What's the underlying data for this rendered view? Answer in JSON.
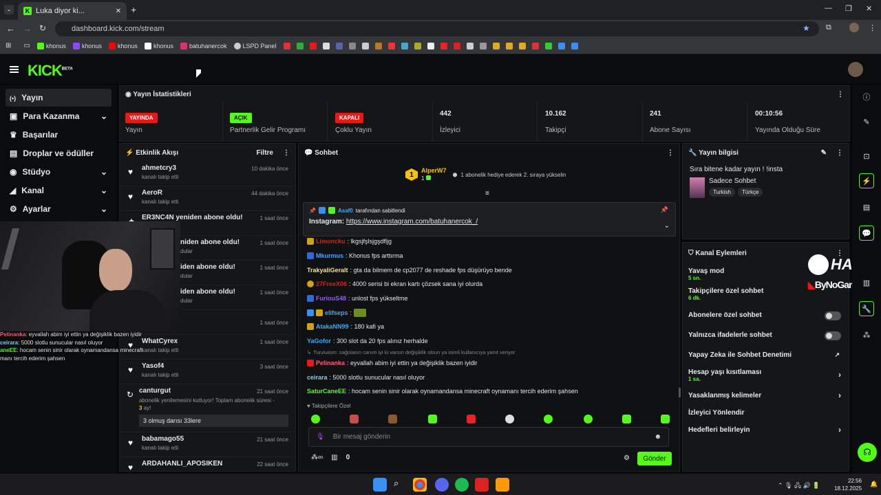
{
  "browser": {
    "tab_title": "Luka diyor ki...",
    "url": "dashboard.kick.com/stream",
    "bookmarks": [
      {
        "label": "khonus",
        "color": "#53fc18"
      },
      {
        "label": "khonus",
        "color": "#9146ff"
      },
      {
        "label": "khonus",
        "color": "#ff0000"
      },
      {
        "label": "khonus",
        "color": "#ffffff"
      },
      {
        "label": "batuhanercok",
        "color": "#e1306c"
      },
      {
        "label": "LSPD Panel",
        "color": "#cccccc"
      }
    ]
  },
  "header": {
    "logo": "KICK",
    "logo_sup": "BETA"
  },
  "sidebar": {
    "items": [
      {
        "label": "Yayın",
        "icon": "broadcast-icon",
        "active": true
      },
      {
        "label": "Para Kazanma",
        "icon": "money-icon",
        "chev": true
      },
      {
        "label": "Başarılar",
        "icon": "trophy-icon"
      },
      {
        "label": "Droplar ve ödüller",
        "icon": "gift-icon"
      },
      {
        "label": "Stüdyo",
        "icon": "studio-icon",
        "chev": true
      },
      {
        "label": "Kanal",
        "icon": "channel-icon",
        "chev": true
      },
      {
        "label": "Ayarlar",
        "icon": "gear-icon",
        "chev": true
      }
    ]
  },
  "stats": {
    "title": "Yayın İstatistikleri",
    "items": [
      {
        "badge": "YAYINDA",
        "badge_color": "#e91916",
        "label": "Yayın"
      },
      {
        "badge": "AÇIK",
        "badge_color": "#53fc18",
        "label": "Partnerlik Gelir Programı"
      },
      {
        "badge": "KAPALI",
        "badge_color": "#e91916",
        "label": "Çoklu Yayın"
      },
      {
        "value": "442",
        "label": "İzleyici"
      },
      {
        "value": "10.162",
        "label": "Takipçi"
      },
      {
        "value": "241",
        "label": "Abone Sayısı"
      },
      {
        "value": "00:10:56",
        "label": "Yayında Olduğu Süre"
      }
    ]
  },
  "activity": {
    "title": "Etkinlik Akışı",
    "filter": "Filtre",
    "items": [
      {
        "user": "ahmetcry3",
        "sub": "kanalı takip etti",
        "time": "10 dakika önce"
      },
      {
        "user": "AeroR",
        "sub": "kanalı takip etti",
        "time": "44 dakika önce"
      },
      {
        "user": "ER3NC4N yeniden abone oldu!",
        "sub": "",
        "time": "1 saat önce"
      },
      {
        "user": "niden abone oldu!",
        "sub": "dular",
        "time": "1 saat önce"
      },
      {
        "user": "iden abone oldu!",
        "sub": "dular",
        "time": "1 saat önce"
      },
      {
        "user": "iden abone oldu!",
        "sub": "dular",
        "time": "1 saat önce"
      },
      {
        "user": "",
        "sub": "kanalı takip etti",
        "time": "1 saat önce"
      },
      {
        "user": "WhatCyrex",
        "sub": "kanalı takip etti",
        "time": "1 saat önce"
      },
      {
        "user": "Yasof4",
        "sub": "kanalı takip etti",
        "time": "3 saat önce"
      }
    ],
    "resub": {
      "user": "canturgut",
      "text": "abonelik yenilemesini kutluyor! Toplam abonelik süresi -",
      "months": "3",
      "unit": "ay!",
      "message": "3 olmuş darısı 33lere",
      "time": "21 saat önce"
    },
    "tail": [
      {
        "user": "babamago55",
        "sub": "kanalı takip etti",
        "time": "21 saat önce"
      },
      {
        "user": "ARDAHANLI_APOSIKEN",
        "sub": "",
        "time": "22 saat önce"
      }
    ]
  },
  "overlay": {
    "brand": "HAWK",
    "brand2": "ByNoGame",
    "chat": [
      {
        "user": "Pelinanka",
        "text": ": eyvallah abim iyi ettin ya değişiklik bazen iyidir",
        "color": "#ff5e7a"
      },
      {
        "user": "ceirara",
        "text": ": 5000 slotlu sunucular nasıl oluyor",
        "color": "#7ad2ff"
      },
      {
        "user": "aneEE",
        "text": ": hocam senin sinir olarak oynamandansa minecraft",
        "color": "#53fc18"
      },
      {
        "user": "",
        "text": "manı tercih ederim şahsen",
        "color": "#fff"
      }
    ]
  },
  "chat": {
    "title": "Sohbet",
    "top": {
      "rank": "1",
      "user": "AlperW7",
      "count": "1",
      "text": "1 abonelik hediye ederek 2. sıraya yükselin"
    },
    "pinned": {
      "by_user": "Asaf0",
      "by_text": "tarafından sabitlendi",
      "label": "Instagram:",
      "link": "https://www.instagram.com/batuhanercok_/"
    },
    "messages": [
      {
        "user": "Limoncku",
        "text": ": lkgsjfşlsjgşdfljg",
        "color": "#e91916",
        "badge": "#d4a017"
      },
      {
        "user": "Mkurmus",
        "text": ": Khonus fps arttırma",
        "color": "#3fa9f5",
        "badge": "#2f6bd8"
      },
      {
        "user": "TrakyaliGeralt",
        "text": ": gta da bilmem de cp2077 de reshade fps düşürüyo bende",
        "color": "#f0e68c",
        "badge": ""
      },
      {
        "user": "27FreeX06",
        "text": ": 4000 serisi bi ekran kartı çözsek sana iyi olurda",
        "color": "#e91916",
        "badge": "#d4a017"
      },
      {
        "user": "FuriouS48",
        "text": ": unlost fps yükseltme",
        "color": "#9b59ff",
        "badge": "#2f6bd8"
      },
      {
        "user": "elifseps",
        "text": ":",
        "color": "#3fa9f5",
        "badge": "#2f6bd8"
      },
      {
        "user": "AtakaNN99",
        "text": ": 180 kafi ya",
        "color": "#3fa9f5",
        "badge": "#d4a017"
      },
      {
        "user": "YaGofor",
        "text": ": 300 slot da 20 fps alınız herhalde",
        "color": "#3fa9f5",
        "badge": ""
      },
      {
        "user": "Pelinanka",
        "text": ": eyvallah abim iyi ettin ya değişiklik bazen iyidir",
        "color": "#ff5e7a",
        "badge": "#e91916",
        "reply": "TunAxiom: sağolasın canım iyi ki varsın değişiklik olsun ya isimli kullanıcıya yanıt veriyor"
      },
      {
        "user": "ceirara",
        "text": ": 5000 slotlu sunucular nasıl oluyor",
        "color": "#7ad2ff",
        "badge": ""
      },
      {
        "user": "SaturCaneEE",
        "text": ": hocam senin sinir olarak oynamandansa minecraft oynamanı tercih ederim şahsen",
        "color": "#53fc18",
        "badge": ""
      }
    ],
    "follower_only": "Takipçilere Özel",
    "input_placeholder": "Bir mesaj gönderin",
    "points": "0",
    "send": "Gönder"
  },
  "stream_info": {
    "title": "Yayın bilgisi",
    "stream_title": "Sıra bitene kadar yayın ! !insta",
    "category": "Sadece Sohbet",
    "tags": [
      "Turkish",
      "Türkçe"
    ]
  },
  "actions": {
    "title": "Kanal Eylemleri",
    "items": [
      {
        "label": "Yavaş mod",
        "sub": "5 sn."
      },
      {
        "label": "Takipçilere özel sohbet",
        "sub": "6 dk."
      },
      {
        "label": "Abonelere özel sohbet",
        "toggle": true
      },
      {
        "label": "Yalnızca ifadelerle sohbet",
        "toggle": true
      },
      {
        "label": "Yapay Zeka ile Sohbet Denetimi"
      },
      {
        "label": "Hesap yaşı kısıtlaması",
        "sub": "1 sa."
      },
      {
        "label": "Yasaklanmış kelimeler"
      },
      {
        "label": "İzleyici Yönlendir"
      },
      {
        "label": "Hedefleri belirleyin"
      }
    ]
  },
  "taskbar": {
    "time": "22:56",
    "date": "18.12.2025"
  }
}
